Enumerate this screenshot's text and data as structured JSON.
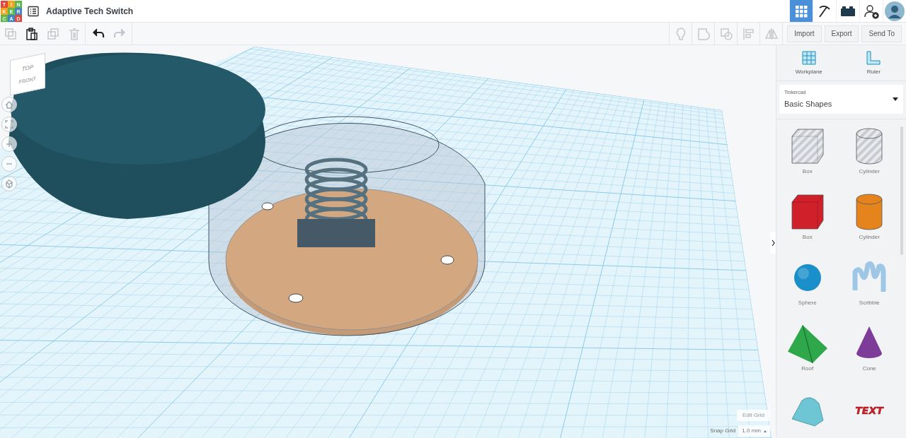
{
  "logo": {
    "rows": [
      [
        "T",
        "I",
        "N"
      ],
      [
        "K",
        "E",
        "R"
      ],
      [
        "C",
        "A",
        "D"
      ]
    ]
  },
  "design_title": "Adaptive Tech Switch",
  "top_icons": [
    {
      "kind": "grid",
      "selected": true
    },
    {
      "kind": "pickaxe",
      "selected": false
    },
    {
      "kind": "bricks",
      "selected": false
    },
    {
      "kind": "add-user",
      "selected": false
    },
    {
      "kind": "avatar",
      "selected": false
    }
  ],
  "toolbar_left": [
    {
      "kind": "copy",
      "disabled": true
    },
    {
      "kind": "paste",
      "disabled": false
    },
    {
      "kind": "duplicate",
      "disabled": true
    },
    {
      "kind": "delete",
      "disabled": true
    },
    {
      "kind": "undo",
      "disabled": false
    },
    {
      "kind": "redo",
      "disabled": true
    }
  ],
  "toolbar_right": [
    {
      "kind": "bulb",
      "disabled": true
    },
    {
      "kind": "group",
      "disabled": true
    },
    {
      "kind": "ungroup",
      "disabled": true
    },
    {
      "kind": "align",
      "disabled": true
    },
    {
      "kind": "mirror",
      "disabled": true
    }
  ],
  "actions": [
    "Import",
    "Export",
    "Send To"
  ],
  "view_cube": {
    "top": "TOP",
    "front": "FRONT"
  },
  "view_controls": [
    {
      "kind": "home"
    },
    {
      "kind": "fit"
    },
    {
      "kind": "zoom-in"
    },
    {
      "kind": "zoom-out"
    },
    {
      "kind": "perspective"
    }
  ],
  "panel_tools": [
    {
      "kind": "workplane",
      "label": "Workplane"
    },
    {
      "kind": "ruler",
      "label": "Ruler"
    }
  ],
  "library": {
    "caption": "Tinkercad",
    "value": "Basic Shapes"
  },
  "shapes": [
    {
      "kind": "box",
      "label": "Box",
      "color": "#c8ccd2",
      "hole": true
    },
    {
      "kind": "cylinder",
      "label": "Cylinder",
      "color": "#c8ccd2",
      "hole": true
    },
    {
      "kind": "box",
      "label": "Box",
      "color": "#d0202a",
      "hole": false
    },
    {
      "kind": "cylinder",
      "label": "Cylinder",
      "color": "#e5831d",
      "hole": false
    },
    {
      "kind": "sphere",
      "label": "Sphere",
      "color": "#1a8fc9",
      "hole": false
    },
    {
      "kind": "scribble",
      "label": "Scribble",
      "color": "#9ec7e6",
      "hole": false
    },
    {
      "kind": "roof",
      "label": "Roof",
      "color": "#2ea84a",
      "hole": false
    },
    {
      "kind": "cone",
      "label": "Cone",
      "color": "#7d3c98",
      "hole": false
    },
    {
      "kind": "round-roof",
      "color": "#6ec6d4",
      "hole": false
    },
    {
      "kind": "text",
      "art_text": "TEXT",
      "color": "#d0202a",
      "hole": false
    }
  ],
  "grid": {
    "edit_label": "Edit Grid",
    "snap_label": "Snap Grid",
    "snap_value": "1.0 mm"
  }
}
